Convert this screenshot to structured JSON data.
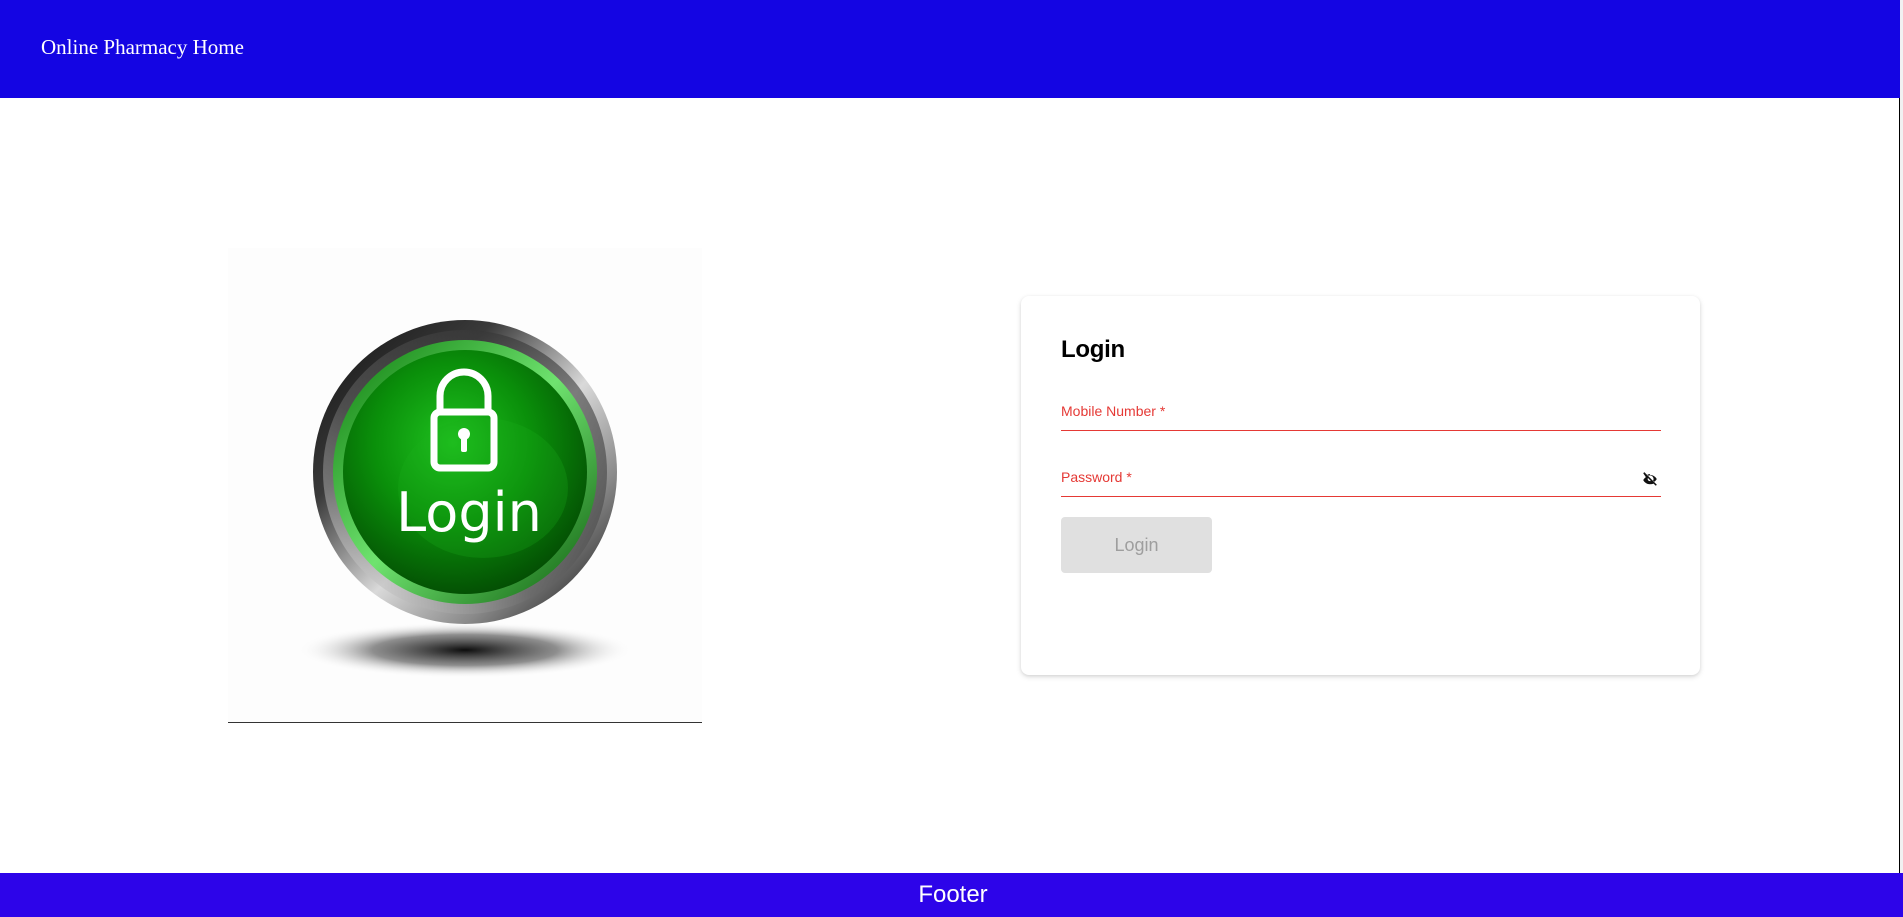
{
  "header": {
    "title": "Online Pharmacy Home",
    "background": "#1405e3"
  },
  "illustration": {
    "icon": "lock-icon",
    "badge_text": "Login"
  },
  "login_form": {
    "title": "Login",
    "mobile_label": "Mobile Number *",
    "password_label": "Password *",
    "visibility_icon": "eye-off-icon",
    "submit_label": "Login",
    "error_color": "#e53935"
  },
  "footer": {
    "text": "Footer",
    "background": "#2d04e9"
  }
}
